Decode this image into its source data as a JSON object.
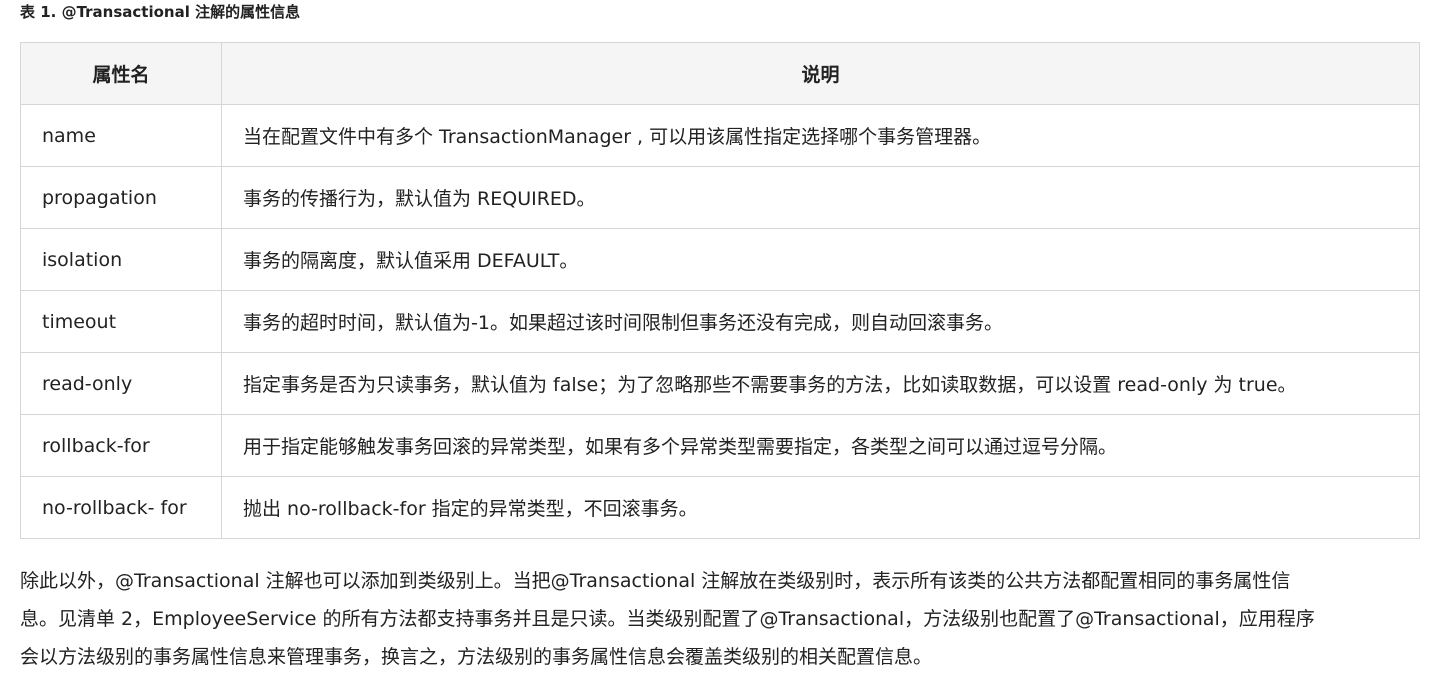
{
  "caption": "表 1. @Transactional 注解的属性信息",
  "table": {
    "headers": [
      "属性名",
      "说明"
    ],
    "rows": [
      {
        "name": "name",
        "desc": "当在配置文件中有多个 TransactionManager , 可以用该属性指定选择哪个事务管理器。"
      },
      {
        "name": "propagation",
        "desc": "事务的传播行为，默认值为 REQUIRED。"
      },
      {
        "name": "isolation",
        "desc": "事务的隔离度，默认值采用 DEFAULT。"
      },
      {
        "name": "timeout",
        "desc": "事务的超时时间，默认值为-1。如果超过该时间限制但事务还没有完成，则自动回滚事务。"
      },
      {
        "name": "read-only",
        "desc": "指定事务是否为只读事务，默认值为 false；为了忽略那些不需要事务的方法，比如读取数据，可以设置 read-only 为 true。"
      },
      {
        "name": "rollback-for",
        "desc": "用于指定能够触发事务回滚的异常类型，如果有多个异常类型需要指定，各类型之间可以通过逗号分隔。"
      },
      {
        "name": "no-rollback- for",
        "desc": "抛出 no-rollback-for 指定的异常类型，不回滚事务。"
      }
    ]
  },
  "paragraph": {
    "lines": [
      "除此以外，@Transactional 注解也可以添加到类级别上。当把@Transactional 注解放在类级别时，表示所有该类的公共方法都配置相同的事务属性信",
      "息。见清单 2，EmployeeService 的所有方法都支持事务并且是只读。当类级别配置了@Transactional，方法级别也配置了@Transactional，应用程序",
      "会以方法级别的事务属性信息来管理事务，换言之，方法级别的事务属性信息会覆盖类级别的相关配置信息。"
    ]
  }
}
